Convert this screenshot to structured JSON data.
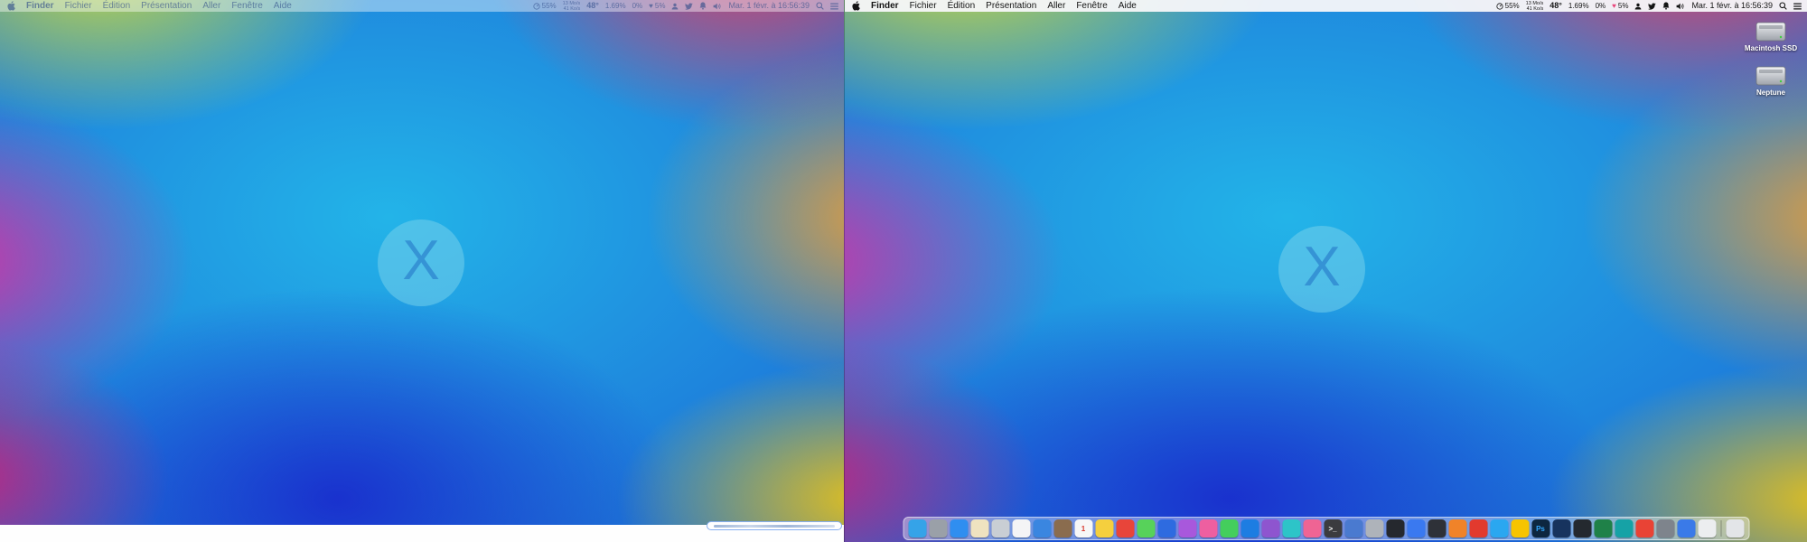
{
  "menu": {
    "items": [
      "Finder",
      "Fichier",
      "Édition",
      "Présentation",
      "Aller",
      "Fenêtre",
      "Aide"
    ],
    "active_item": "Finder"
  },
  "status": {
    "cpu": "55%",
    "net_down": "13 Mo/s",
    "net_up": "41 Ko/s",
    "temp": "48°",
    "mem": "1.69%",
    "gpu": "0%",
    "health": "5%",
    "clock": "Mar. 1 févr. à 16:56:39"
  },
  "wallpaper": {
    "circle_letter": "X"
  },
  "right_display": {
    "desktop_icons": [
      {
        "label": "Macintosh SSD"
      },
      {
        "label": "Neptune"
      }
    ],
    "dock": {
      "items": [
        {
          "name": "finder",
          "color": "#35a3e8",
          "glyph": ""
        },
        {
          "name": "launchpad",
          "color": "#9aa0a8",
          "glyph": ""
        },
        {
          "name": "safari",
          "color": "#2f8ef0",
          "glyph": ""
        },
        {
          "name": "notes",
          "color": "#efe3c0",
          "glyph": ""
        },
        {
          "name": "app-gray",
          "color": "#c9ced4",
          "glyph": ""
        },
        {
          "name": "app-white",
          "color": "#f4f4f6",
          "glyph": ""
        },
        {
          "name": "mail",
          "color": "#3a86e0",
          "glyph": ""
        },
        {
          "name": "app-brown",
          "color": "#8a6c4e",
          "glyph": ""
        },
        {
          "name": "calendar",
          "color": "#f7f7f7",
          "glyph": "1",
          "fg": "#d8382e"
        },
        {
          "name": "app-yellow",
          "color": "#f5cf3e",
          "glyph": ""
        },
        {
          "name": "app-red",
          "color": "#e8453a",
          "glyph": ""
        },
        {
          "name": "messages",
          "color": "#57d25a",
          "glyph": ""
        },
        {
          "name": "app-blue",
          "color": "#2e6be0",
          "glyph": ""
        },
        {
          "name": "app-purple",
          "color": "#a858dc",
          "glyph": ""
        },
        {
          "name": "music",
          "color": "#ee5fa0",
          "glyph": ""
        },
        {
          "name": "facetime",
          "color": "#44ce5c",
          "glyph": ""
        },
        {
          "name": "appstore",
          "color": "#1d7de2",
          "glyph": ""
        },
        {
          "name": "podcasts",
          "color": "#8e55cf",
          "glyph": ""
        },
        {
          "name": "app-teal",
          "color": "#2dc4c8",
          "glyph": ""
        },
        {
          "name": "app-pink",
          "color": "#ef6494",
          "glyph": ""
        },
        {
          "name": "terminal",
          "color": "#3b3b3f",
          "glyph": ">_",
          "fg": "#ffffff"
        },
        {
          "name": "app-blue-2",
          "color": "#4a7ad0",
          "glyph": ""
        },
        {
          "name": "app-silver",
          "color": "#aeb3ba",
          "glyph": ""
        },
        {
          "name": "app-black",
          "color": "#25282e",
          "glyph": ""
        },
        {
          "name": "app-blue-3",
          "color": "#3a79f0",
          "glyph": ""
        },
        {
          "name": "app-dark",
          "color": "#2e3138",
          "glyph": ""
        },
        {
          "name": "vlc",
          "color": "#f08329",
          "glyph": ""
        },
        {
          "name": "app-red-2",
          "color": "#e23a2e",
          "glyph": ""
        },
        {
          "name": "app-blue-4",
          "color": "#2aa7f0",
          "glyph": ""
        },
        {
          "name": "app-yellow-2",
          "color": "#f6c400",
          "glyph": ""
        },
        {
          "name": "photoshop",
          "color": "#0d2740",
          "glyph": "Ps",
          "fg": "#31a8ff"
        },
        {
          "name": "app-navy",
          "color": "#17335e",
          "glyph": ""
        },
        {
          "name": "github",
          "color": "#24292f",
          "glyph": ""
        },
        {
          "name": "app-green",
          "color": "#1f8148",
          "glyph": ""
        },
        {
          "name": "app-teal-2",
          "color": "#16a2a6",
          "glyph": ""
        },
        {
          "name": "app-red-3",
          "color": "#e94335",
          "glyph": ""
        },
        {
          "name": "app-gray-2",
          "color": "#7e848c",
          "glyph": ""
        },
        {
          "name": "app-blue-5",
          "color": "#3a7ae8",
          "glyph": ""
        },
        {
          "name": "textedit",
          "color": "#eceef0",
          "glyph": ""
        },
        {
          "name": "trash",
          "color": "#e3e5e8",
          "glyph": ""
        }
      ]
    }
  }
}
